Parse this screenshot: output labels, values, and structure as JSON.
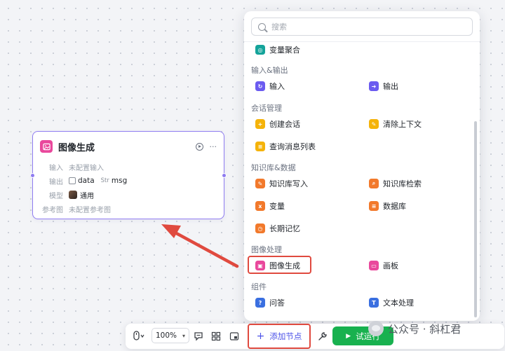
{
  "node": {
    "title": "图像生成",
    "more": "···",
    "rows": {
      "input_label": "输入",
      "input_value": "未配置输入",
      "output_label": "输出",
      "output_tag1_type": "🖼",
      "output_tag1_name": "data",
      "output_tag2_type": "Str",
      "output_tag2_name": "msg",
      "model_label": "模型",
      "model_value": "通用",
      "ref_label": "参考图",
      "ref_value": "未配置参考图"
    }
  },
  "panel": {
    "search_placeholder": "搜索",
    "sections": {
      "io": "输入&输出",
      "chat": "会话管理",
      "kb": "知识库&数据",
      "image": "图像处理",
      "component": "组件"
    },
    "items": {
      "var_agg": "变量聚合",
      "input": "输入",
      "output": "输出",
      "create_chat": "创建会话",
      "clear_context": "清除上下文",
      "query_messages": "查询消息列表",
      "kb_write": "知识库写入",
      "kb_search": "知识库检索",
      "variable": "变量",
      "database": "数据库",
      "long_memory": "长期记忆",
      "image_gen": "图像生成",
      "canvas": "画板",
      "qa": "问答",
      "text_proc": "文本处理"
    },
    "colors": {
      "teal": "#14a39a",
      "purple": "#6b5bf0",
      "yellow": "#f5b30a",
      "orange": "#f2792b",
      "pink": "#e9489c",
      "blue": "#3a6fe0"
    }
  },
  "toolbar": {
    "zoom": "100%",
    "add_node": "添加节点",
    "run": "试运行"
  },
  "watermark": "公众号 · 斜杠君",
  "highlight_color": "#e04a3f"
}
